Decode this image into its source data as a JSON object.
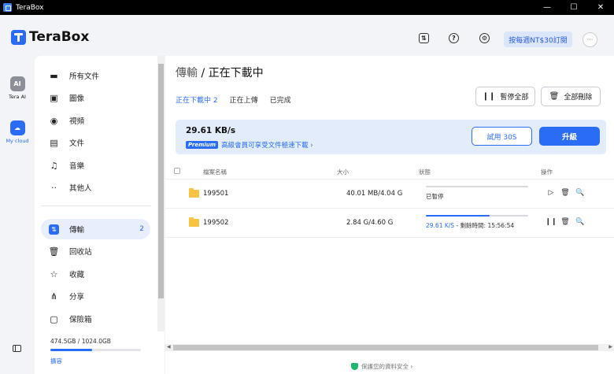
{
  "window": {
    "title": "TeraBox",
    "controls": [
      "—",
      "☐",
      "✕"
    ]
  },
  "header": {
    "logo_text": "TeraBox",
    "promo_label": "按每週NT$30訂閱",
    "avatar_text": "···"
  },
  "rail": {
    "items": [
      {
        "icon_text": "AI",
        "label": "Tera AI"
      },
      {
        "icon_text": "☁",
        "label": "My cloud"
      }
    ]
  },
  "sidebar": {
    "items": [
      {
        "icon": "all-files-icon",
        "glyph": "▬",
        "label": "所有文件"
      },
      {
        "icon": "image-icon",
        "glyph": "▣",
        "label": "圖像"
      },
      {
        "icon": "video-icon",
        "glyph": "◉",
        "label": "視頻"
      },
      {
        "icon": "document-icon",
        "glyph": "▤",
        "label": "文件"
      },
      {
        "icon": "music-icon",
        "glyph": "♫",
        "label": "音樂"
      },
      {
        "icon": "others-icon",
        "glyph": "··",
        "label": "其他人"
      }
    ],
    "tools": [
      {
        "icon": "transfer-icon",
        "glyph": "⇅",
        "label": "傳輸",
        "count": "2"
      },
      {
        "icon": "recycle-bin-icon",
        "glyph": "🗑",
        "label": "回收站"
      },
      {
        "icon": "star-icon",
        "glyph": "☆",
        "label": "收藏"
      },
      {
        "icon": "share-icon",
        "glyph": "⋔",
        "label": "分享"
      },
      {
        "icon": "safe-icon",
        "glyph": "▢",
        "label": "保險箱"
      }
    ],
    "storage": {
      "text": "474.5GB / 1024.0GB",
      "used_fraction": 0.463,
      "expand_label": "擴容"
    }
  },
  "main": {
    "title_prefix": "傳輸",
    "title_sep": " / ",
    "title_current": "正在下載中",
    "tabs": [
      {
        "label": "正在下載中 2"
      },
      {
        "label": "正在上傳"
      },
      {
        "label": "已完成"
      }
    ],
    "pause_all_label": "暫停全部",
    "delete_all_label": "全部刪除",
    "banner": {
      "speed": "29.61 KB/s",
      "badge": "Premium",
      "message": "高級會員可享受文件極速下載 ›",
      "trial_label": "試用 30S",
      "upgrade_label": "升級"
    },
    "columns": {
      "name": "檔案名稱",
      "size": "大小",
      "status": "狀態",
      "actions": "操作"
    },
    "rows": [
      {
        "name": "199501",
        "size": "40.01 MB/4.04 G",
        "progress": 0.0,
        "speed": "",
        "status": "已暫停"
      },
      {
        "name": "199502",
        "size": "2.84 G/4.60 G",
        "progress": 0.62,
        "speed": "29.61 K/S",
        "status": " - 剩餘時間: 15:56:54"
      }
    ],
    "privacy": "保護您的資料安全 ›"
  },
  "colors": {
    "accent": "#2a6cf6",
    "folder": "#f6c343",
    "banner_bg": "#e3ecfb"
  }
}
